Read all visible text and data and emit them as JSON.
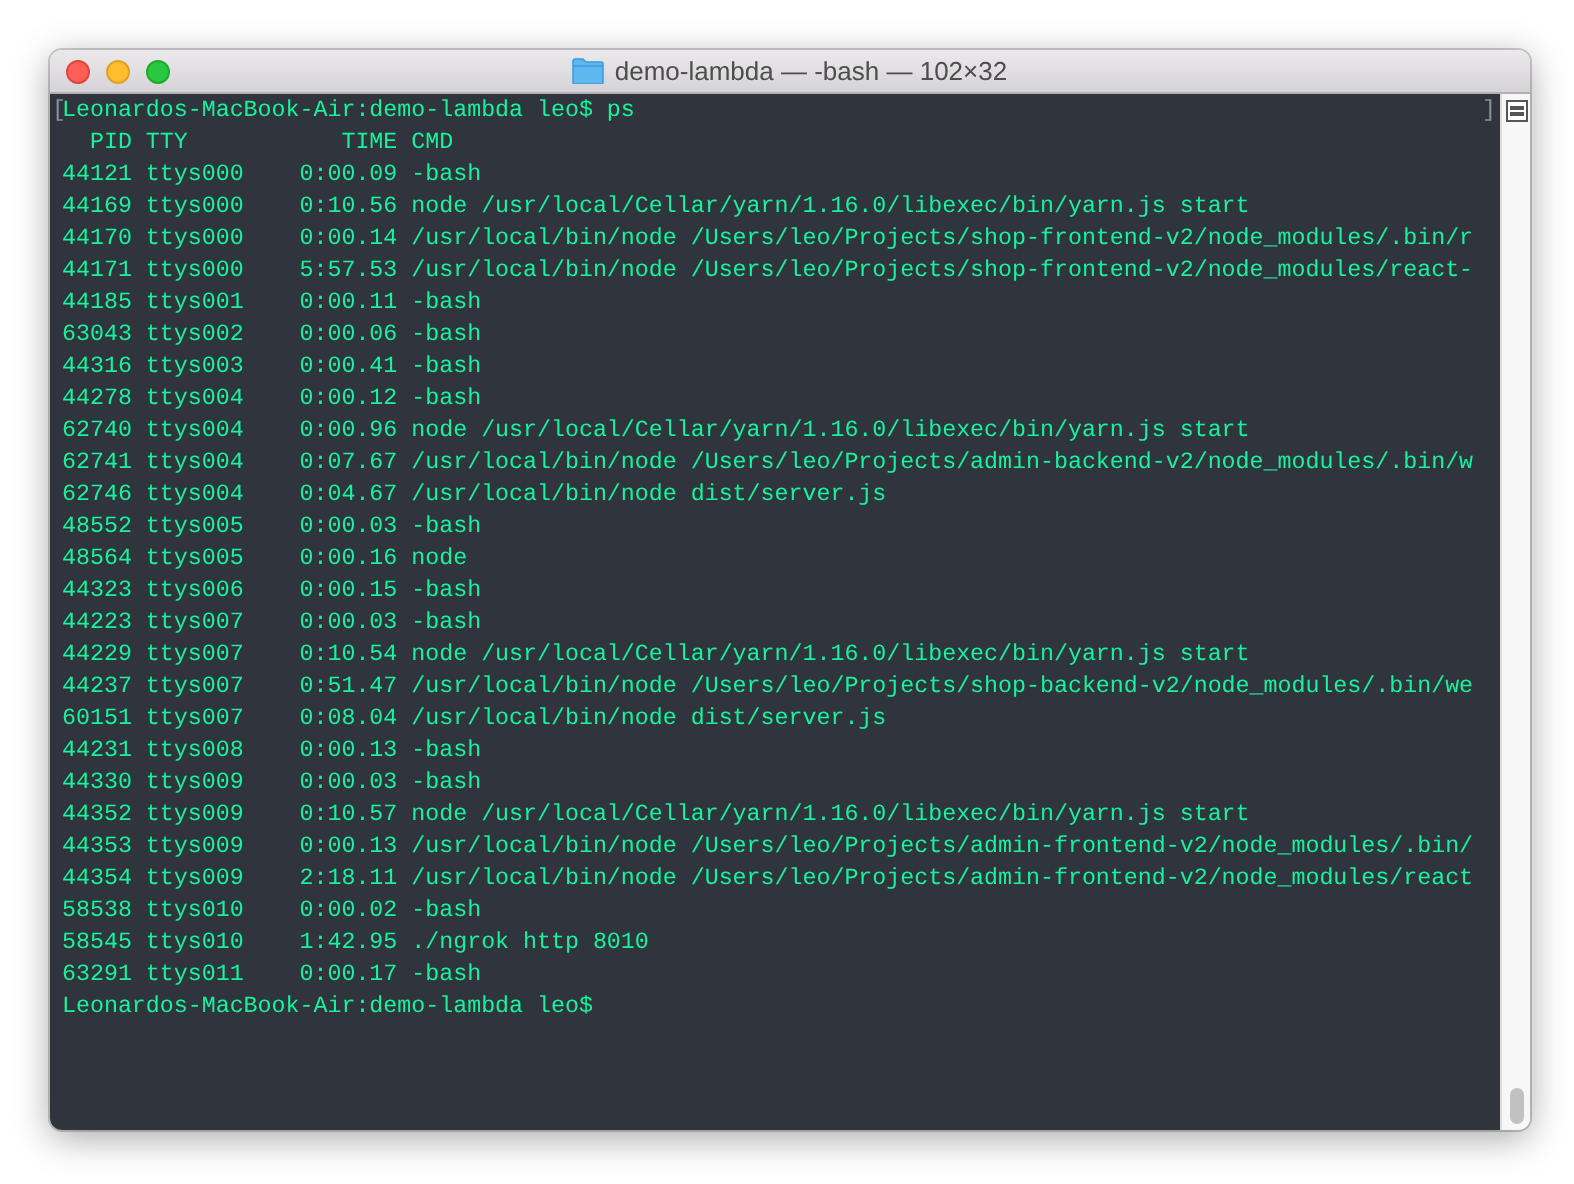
{
  "window": {
    "title": "demo-lambda — -bash — 102×32"
  },
  "terminal": {
    "mark_start": "[",
    "mark_end": "]",
    "lines": [
      "Leonardos-MacBook-Air:demo-lambda leo$ ps",
      "  PID TTY           TIME CMD",
      "44121 ttys000    0:00.09 -bash",
      "44169 ttys000    0:10.56 node /usr/local/Cellar/yarn/1.16.0/libexec/bin/yarn.js start",
      "44170 ttys000    0:00.14 /usr/local/bin/node /Users/leo/Projects/shop-frontend-v2/node_modules/.bin/r",
      "44171 ttys000    5:57.53 /usr/local/bin/node /Users/leo/Projects/shop-frontend-v2/node_modules/react-",
      "44185 ttys001    0:00.11 -bash",
      "63043 ttys002    0:00.06 -bash",
      "44316 ttys003    0:00.41 -bash",
      "44278 ttys004    0:00.12 -bash",
      "62740 ttys004    0:00.96 node /usr/local/Cellar/yarn/1.16.0/libexec/bin/yarn.js start",
      "62741 ttys004    0:07.67 /usr/local/bin/node /Users/leo/Projects/admin-backend-v2/node_modules/.bin/w",
      "62746 ttys004    0:04.67 /usr/local/bin/node dist/server.js",
      "48552 ttys005    0:00.03 -bash",
      "48564 ttys005    0:00.16 node",
      "44323 ttys006    0:00.15 -bash",
      "44223 ttys007    0:00.03 -bash",
      "44229 ttys007    0:10.54 node /usr/local/Cellar/yarn/1.16.0/libexec/bin/yarn.js start",
      "44237 ttys007    0:51.47 /usr/local/bin/node /Users/leo/Projects/shop-backend-v2/node_modules/.bin/we",
      "60151 ttys007    0:08.04 /usr/local/bin/node dist/server.js",
      "44231 ttys008    0:00.13 -bash",
      "44330 ttys009    0:00.03 -bash",
      "44352 ttys009    0:10.57 node /usr/local/Cellar/yarn/1.16.0/libexec/bin/yarn.js start",
      "44353 ttys009    0:00.13 /usr/local/bin/node /Users/leo/Projects/admin-frontend-v2/node_modules/.bin/",
      "44354 ttys009    2:18.11 /usr/local/bin/node /Users/leo/Projects/admin-frontend-v2/node_modules/react",
      "58538 ttys010    0:00.02 -bash",
      "58545 ttys010    1:42.95 ./ngrok http 8010",
      "63291 ttys011    0:00.17 -bash",
      "Leonardos-MacBook-Air:demo-lambda leo$"
    ]
  }
}
